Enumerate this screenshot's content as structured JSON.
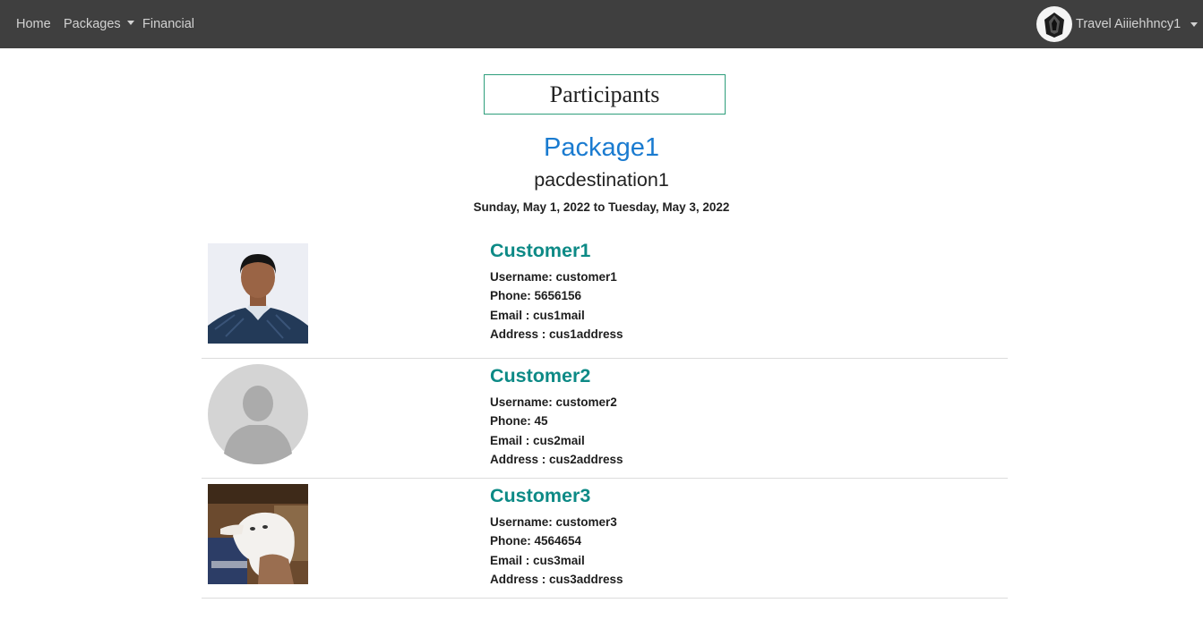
{
  "nav": {
    "home": "Home",
    "packages": "Packages",
    "financial": "Financial",
    "user_name": "Travel Aiiiehhncy1"
  },
  "page": {
    "title": "Participants",
    "package_name": "Package1",
    "destination": "pacdestination1",
    "dates": "Sunday, May 1, 2022 to Tuesday, May 3, 2022"
  },
  "customers": [
    {
      "name": "Customer1",
      "username": "Username: customer1",
      "phone": "Phone: 5656156",
      "email": "Email : cus1mail",
      "address": "Address : cus1address",
      "photo": "person-photo"
    },
    {
      "name": "Customer2",
      "username": "Username: customer2",
      "phone": "Phone: 45",
      "email": "Email : cus2mail",
      "address": "Address : cus2address",
      "photo": "default-avatar"
    },
    {
      "name": "Customer3",
      "username": "Username: customer3",
      "phone": "Phone: 4564654",
      "email": "Email : cus3mail",
      "address": "Address : cus3address",
      "photo": "cat-photo"
    }
  ],
  "colors": {
    "navbar": "#3f3f3f",
    "package_title": "#1a7bd0",
    "customer_name": "#0d8a86",
    "title_border": "#2e9e7b"
  }
}
